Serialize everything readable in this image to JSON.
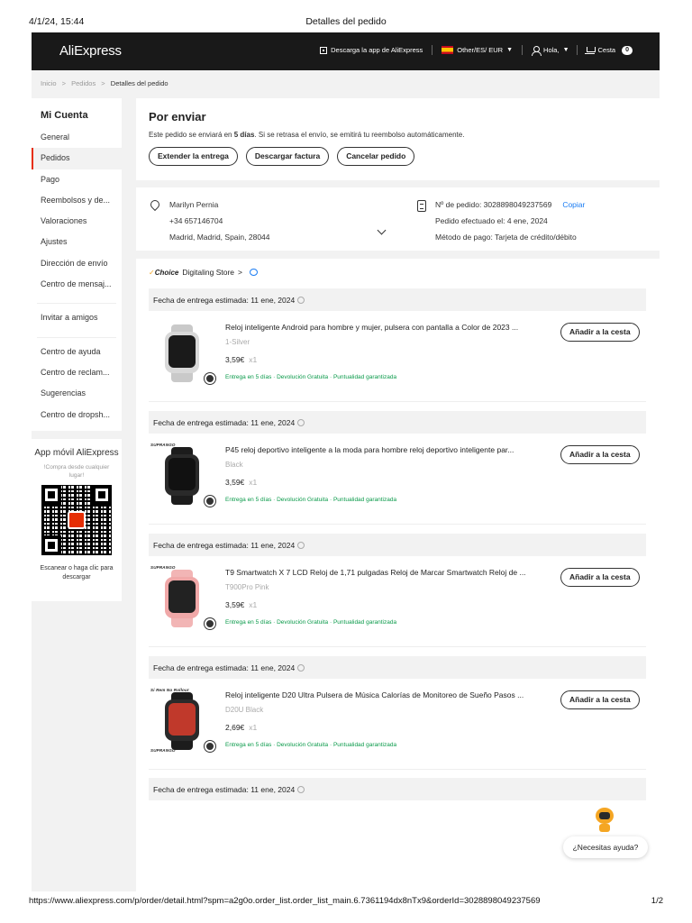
{
  "print_header": {
    "date": "4/1/24, 15:44",
    "title": "Detalles del pedido"
  },
  "print_footer": {
    "url": "https://www.aliexpress.com/p/order/detail.html?spm=a2g0o.order_list.order_list_main.6.7361194dx8nTx9&orderId=3028898049237569",
    "page": "1/2"
  },
  "topbar": {
    "logo": "AliExpress",
    "download_app": "Descarga la app de AliExpress",
    "locale": "Other/ES/ EUR",
    "greeting": "Hola,",
    "cart_label": "Cesta",
    "cart_count": "0",
    "colors": {
      "bar": "#191919",
      "accent": "#e62e04"
    }
  },
  "breadcrumb": [
    "Inicio",
    "Pedidos",
    "Detalles del pedido"
  ],
  "breadcrumb_sep": ">",
  "sidebar": {
    "heading": "Mi Cuenta",
    "items": [
      "General",
      "Pedidos",
      "Pago",
      "Reembolsos y de...",
      "Valoraciones",
      "Ajustes",
      "Dirección de envío",
      "Centro de mensaj..."
    ],
    "invite": "Invitar a amigos",
    "support": [
      "Centro de ayuda",
      "Centro de reclam...",
      "Sugerencias",
      "Centro de dropsh..."
    ],
    "active_item": "Pedidos"
  },
  "app_card": {
    "title": "App móvil AliExpress",
    "subtitle": "!Compra desde cualquier lugar!",
    "caption": "Escanear o haga clic para descargar"
  },
  "status": {
    "title": "Por enviar",
    "message_before": "Este pedido se enviará en ",
    "message_bold": "5 días",
    "message_after": ". Si se retrasa el envío, se emitirá tu reembolso automáticamente.",
    "buttons": [
      "Extender la entrega",
      "Descargar factura",
      "Cancelar pedido"
    ]
  },
  "address": {
    "name": "Marilyn Pernia",
    "phone": "+34 657146704",
    "location": "Madrid, Madrid, Spain, 28044"
  },
  "order": {
    "number": "Nº de pedido: 3028898049237569",
    "copy": "Copiar",
    "placed": "Pedido efectuado el: 4 ene, 2024",
    "payment": "Método de pago: Tarjeta de crédito/débito"
  },
  "store": {
    "choice_label": "Choice",
    "name": "Digitaling Store",
    "arrow": ">"
  },
  "delivery_label": "Fecha de entrega estimada: 11 ene, 2024",
  "add_to_cart": "Añadir a la cesta",
  "products": [
    {
      "name": "Reloj inteligente Android para hombre y mujer, pulsera con pantalla a Color de 2023 ...",
      "variant": "1-Silver",
      "price": "3,59€",
      "qty": "x1",
      "note": "Entrega en 5 días · Devolución Gratuita · Puntualidad garantizada",
      "sub_logo": "",
      "sub_logo_bottom": "",
      "colors": {
        "strap": "#c9c9c9",
        "case": "#d8d8d8",
        "face": "#1a1a1a"
      }
    },
    {
      "name": "P45 reloj deportivo inteligente a la moda para hombre reloj deportivo inteligente par...",
      "variant": "Black",
      "price": "3,59€",
      "qty": "x1",
      "note": "Entrega en 5 días · Devolución Gratuita · Puntualidad garantizada",
      "sub_logo": "SUPRANGO",
      "sub_logo_bottom": "",
      "colors": {
        "strap": "#1c1c1c",
        "case": "#2a2a2a",
        "face": "#111111"
      }
    },
    {
      "name": "T9 Smartwatch X 7 LCD Reloj de 1,71 pulgadas Reloj de Marcar Smartwatch Reloj de ...",
      "variant": "T900Pro Pink",
      "price": "3,59€",
      "qty": "x1",
      "note": "Entrega en 5 días · Devolución Gratuita · Puntualidad garantizada",
      "sub_logo": "SUPRANGO",
      "sub_logo_bottom": "",
      "colors": {
        "strap": "#f2b5b5",
        "case": "#f0a8a8",
        "face": "#222222"
      }
    },
    {
      "name": "Reloj inteligente D20 Ultra Pulsera de Música Calorías de Monitoreo de Sueño Pasos ...",
      "variant": "D20U Black",
      "price": "2,69€",
      "qty": "x1",
      "note": "Entrega en 5 días · Devolución Gratuita · Puntualidad garantizada",
      "sub_logo": "Si Rem No Rollour",
      "sub_logo_bottom": "SUPRANGO",
      "colors": {
        "strap": "#1c1c1c",
        "case": "#2a2a2a",
        "face": "#c0392b"
      }
    }
  ],
  "help": {
    "label": "¿Necesitas ayuda?"
  }
}
